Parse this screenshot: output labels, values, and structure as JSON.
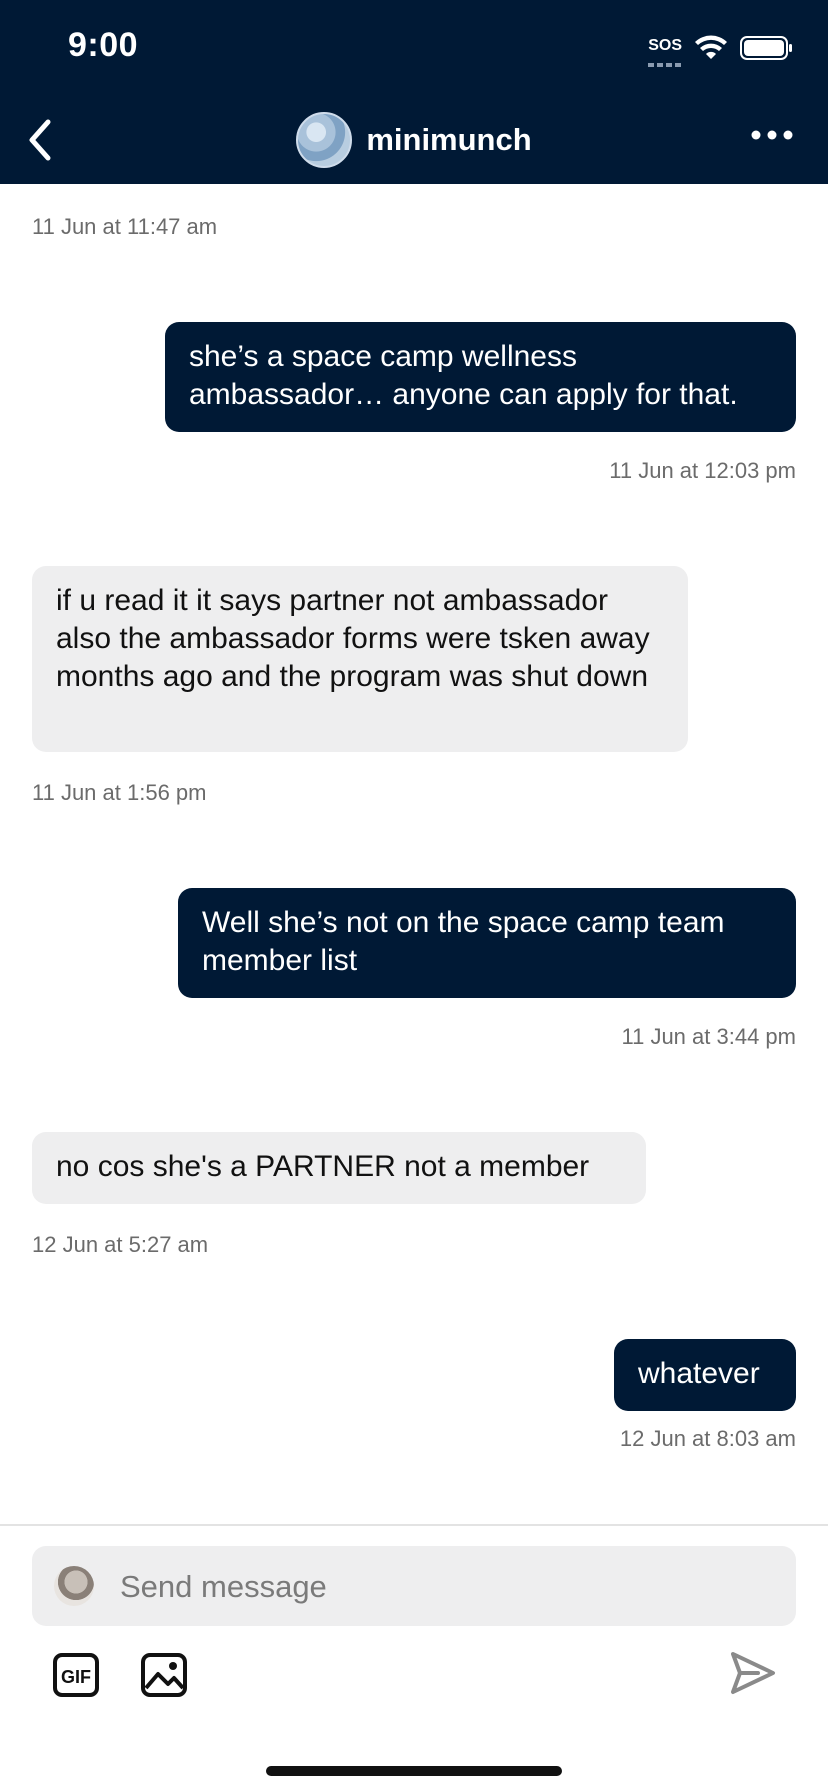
{
  "status_bar": {
    "time": "9:00",
    "sos": "SOS"
  },
  "nav": {
    "blog_name": "minimunch",
    "icons": {
      "back": "back-chevron-icon",
      "more": "more-dots-icon"
    }
  },
  "messages": [
    {
      "type": "timestamp",
      "side": "left",
      "text": "11 Jun at 11:47 am"
    },
    {
      "type": "bubble",
      "side": "out",
      "text": "she’s a space camp wellness ambassador… anyone can apply for that."
    },
    {
      "type": "timestamp",
      "side": "right",
      "text": "11 Jun at 12:03 pm"
    },
    {
      "type": "bubble",
      "side": "in",
      "text": "if u read it it says partner not ambassador also the ambassador forms were tsken away months ago and the program was shut down"
    },
    {
      "type": "timestamp",
      "side": "left",
      "text": "11 Jun at 1:56 pm"
    },
    {
      "type": "bubble",
      "side": "out",
      "text": "Well she’s not on the space camp team member list"
    },
    {
      "type": "timestamp",
      "side": "right",
      "text": "11 Jun at 3:44 pm"
    },
    {
      "type": "bubble",
      "side": "in",
      "text": "no cos she's a PARTNER not a member"
    },
    {
      "type": "timestamp",
      "side": "left",
      "text": "12 Jun at 5:27 am"
    },
    {
      "type": "bubble",
      "side": "out",
      "text": "whatever"
    },
    {
      "type": "timestamp",
      "side": "right",
      "text": "12 Jun at 8:03 am"
    }
  ],
  "composer": {
    "placeholder": "Send message",
    "gif_label": "GIF",
    "icons": {
      "gif": "gif-icon",
      "image": "image-icon",
      "send": "send-icon"
    }
  },
  "colors": {
    "header_bg": "#001935",
    "outgoing_bubble": "#001935",
    "incoming_bubble": "#eeeeef",
    "timestamp": "#6b6b6b"
  }
}
